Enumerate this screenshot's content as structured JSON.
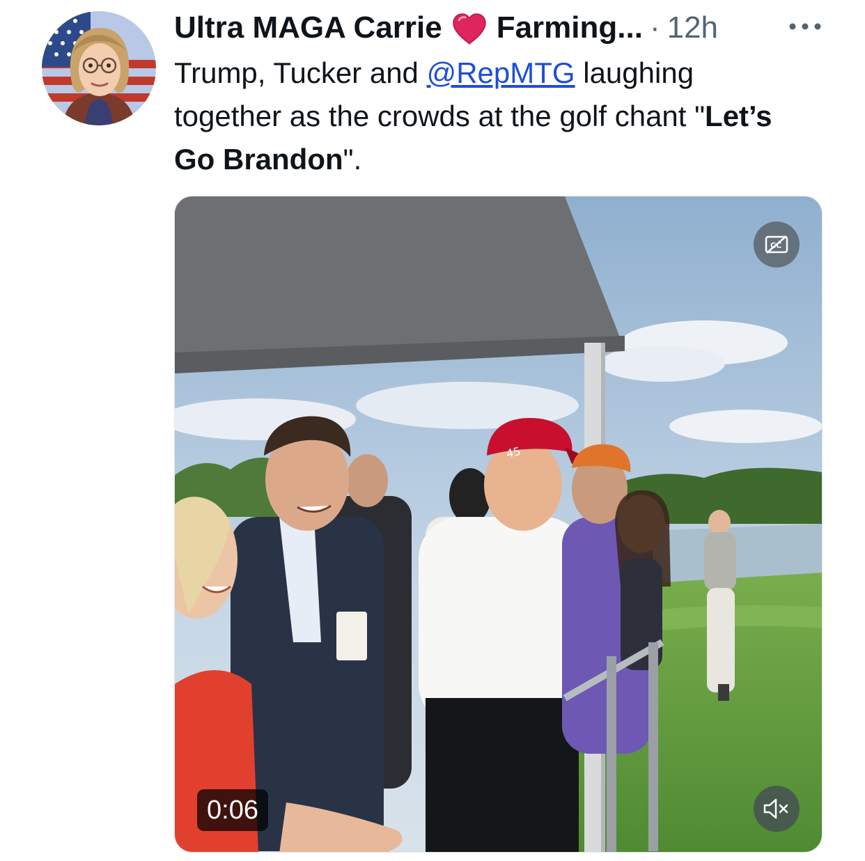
{
  "tweet": {
    "author": {
      "display_name": "Ultra MAGA Carrie",
      "badge_icon": "red-heart-icon",
      "handle": "Farming...",
      "separator": "·",
      "time": "12h",
      "avatar_icon": "profile-avatar"
    },
    "more_icon": "ellipsis-icon",
    "text": {
      "part1": "Trump, Tucker and ",
      "mention": "@RepMTG",
      "part2": " laughing together as the crowds at the golf chant ",
      "quote_open": "\"",
      "bold": "Let’s Go Brandon",
      "quote_close": "\"."
    },
    "media": {
      "type": "video",
      "duration": "0:06",
      "cc_icon": "closed-captions-off-icon",
      "mute_icon": "speaker-muted-icon",
      "hat_text": "45"
    }
  },
  "colors": {
    "text": "#0f1419",
    "secondary": "#536471",
    "mention": "#1d4ed8",
    "heart": "#e0245e"
  }
}
